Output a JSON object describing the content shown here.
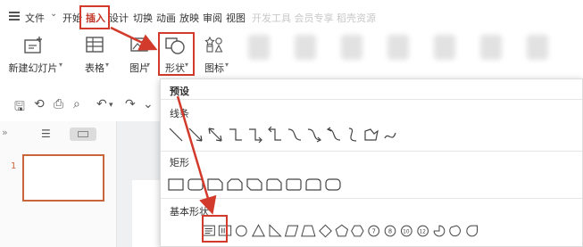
{
  "menubar": {
    "menu_icon": "hamburger-menu-icon",
    "file_label": "文件",
    "start_label": "开始",
    "insert_label": "插入",
    "design_label": "设计",
    "transition_label": "切换",
    "animation_label": "动画",
    "slideshow_label": "放映",
    "review_label": "审阅",
    "view_label": "视图",
    "faded_label": "开发工具  会员专享  稻壳资源"
  },
  "ribbon": {
    "new_slide_label": "新建幻灯片",
    "table_label": "表格",
    "picture_label": "图片",
    "shape_label": "形状",
    "icon_label": "图标"
  },
  "dropdown": {
    "preset_label": "预设",
    "lines_label": "线条",
    "rect_label": "矩形",
    "basic_label": "基本形状"
  },
  "slides": {
    "slide1_number": "1"
  },
  "colors": {
    "highlight": "#d23a2b",
    "accent": "#c9653a"
  }
}
